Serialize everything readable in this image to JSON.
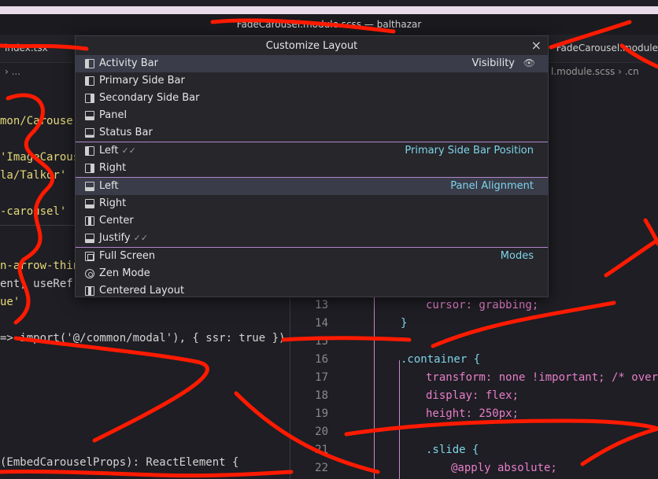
{
  "window": {
    "title": "FadeCarousel.module.scss — balthazar"
  },
  "tabs": {
    "left": "index.tsx",
    "right": "FadeCarousel.module"
  },
  "breadcrumbs": {
    "left": "› ...",
    "right": "l.module.scss › .cn"
  },
  "left_code": [
    {
      "text": "mon/Carouse",
      "color": "yellow"
    },
    {
      "text": "'ImageCarous",
      "color": "yellow"
    },
    {
      "text": "la/Talkor'",
      "color": "yellow"
    },
    {
      "text": "-carousel'",
      "color": "yellow"
    },
    {
      "text": "n-arrow-thin",
      "color": "yellow"
    },
    {
      "text": "ent, useRef,",
      "color": "white"
    },
    {
      "text": "ue'",
      "color": "yellow"
    },
    {
      "text": "=> import('@/common/modal'), { ssr: true })",
      "color": "white"
    },
    {
      "text": "(EmbedCarouselProps): ReactElement {",
      "color": "white"
    }
  ],
  "right_code": [
    {
      "num": "13",
      "text": "cursor: grabbing;",
      "indent": 1
    },
    {
      "num": "14",
      "text": "}",
      "indent": 0
    },
    {
      "num": "15",
      "text": "",
      "indent": 0
    },
    {
      "num": "16",
      "text": ".container {",
      "indent": 0
    },
    {
      "num": "17",
      "text": "transform: none !important; /* overi",
      "indent": 1
    },
    {
      "num": "18",
      "text": "display: flex;",
      "indent": 1
    },
    {
      "num": "19",
      "text": "height: 250px;",
      "indent": 1
    },
    {
      "num": "20",
      "text": "",
      "indent": 0
    },
    {
      "num": "21",
      "text": ".slide {",
      "indent": 1
    },
    {
      "num": "22",
      "text": "@apply absolute;",
      "indent": 2
    }
  ],
  "dialog": {
    "title": "Customize Layout",
    "close_label": "×",
    "sections": [
      {
        "header": "Visibility",
        "items": [
          {
            "label": "Activity Bar",
            "icon": "activity-bar-icon",
            "active": true
          },
          {
            "label": "Primary Side Bar",
            "icon": "primary-side-bar-icon"
          },
          {
            "label": "Secondary Side Bar",
            "icon": "secondary-side-bar-icon"
          },
          {
            "label": "Panel",
            "icon": "panel-icon"
          },
          {
            "label": "Status Bar",
            "icon": "status-bar-icon"
          }
        ]
      },
      {
        "header": "Primary Side Bar Position",
        "items": [
          {
            "label": "Left",
            "checked": true,
            "icon": "side-bar-left-icon"
          },
          {
            "label": "Right",
            "icon": "side-bar-right-icon"
          }
        ]
      },
      {
        "header": "Panel Alignment",
        "items": [
          {
            "label": "Left",
            "icon": "panel-align-left-icon",
            "active": true
          },
          {
            "label": "Right",
            "icon": "panel-align-right-icon"
          },
          {
            "label": "Center",
            "icon": "panel-align-center-icon"
          },
          {
            "label": "Justify",
            "checked": true,
            "icon": "panel-align-justify-icon"
          }
        ]
      },
      {
        "header": "Modes",
        "items": [
          {
            "label": "Full Screen",
            "icon": "full-screen-icon"
          },
          {
            "label": "Zen Mode",
            "icon": "zen-mode-icon"
          },
          {
            "label": "Centered Layout",
            "icon": "centered-layout-icon"
          }
        ]
      }
    ],
    "check_mark": "✓✓",
    "eye_glyph": "👁"
  },
  "colors": {
    "accent_cyan": "#7fd4e8",
    "separator": "#b086c9",
    "scribble": "#ff1a00"
  }
}
